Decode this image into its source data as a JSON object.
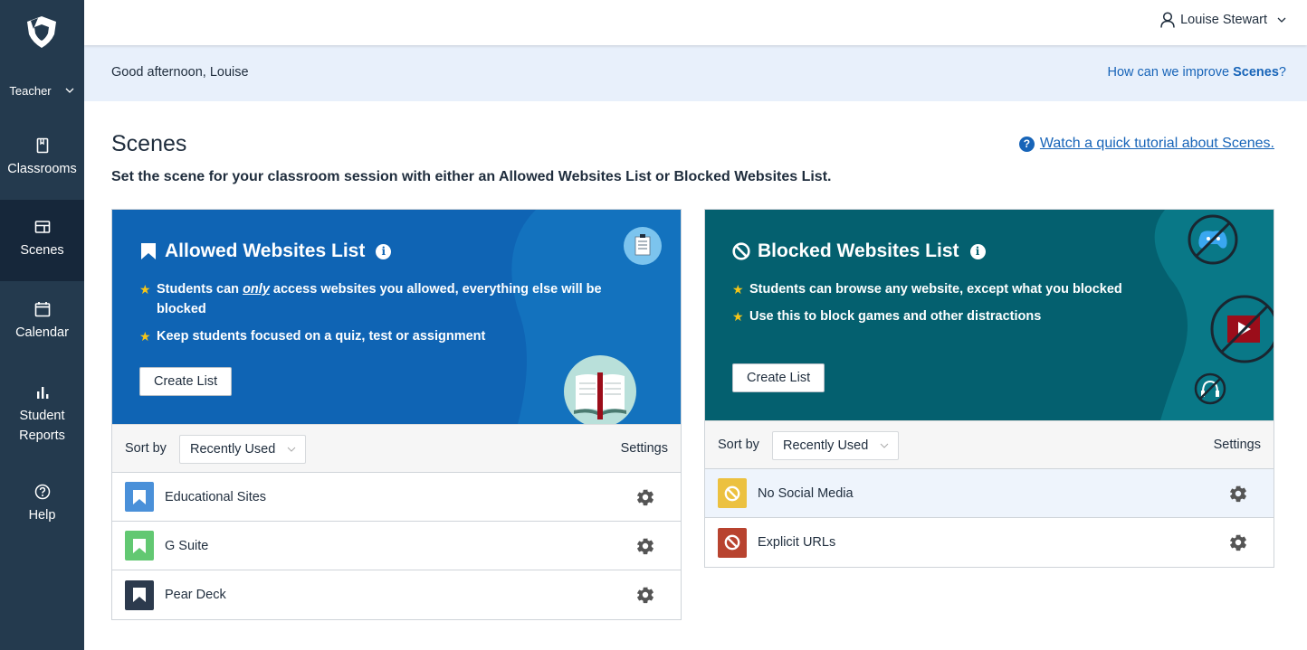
{
  "sidebar": {
    "role": "Teacher",
    "items": [
      {
        "label": "Classrooms",
        "icon": "book-icon"
      },
      {
        "label": "Scenes",
        "icon": "layout-icon",
        "active": true
      },
      {
        "label": "Calendar",
        "icon": "calendar-icon"
      },
      {
        "label": "Student Reports",
        "icon": "bar-chart-icon"
      },
      {
        "label": "Help",
        "icon": "help-circle-icon"
      }
    ]
  },
  "topbar": {
    "user_name": "Louise Stewart"
  },
  "greeting": {
    "text": "Good afternoon, Louise",
    "improve_prefix": "How can we improve ",
    "improve_bold": "Scenes",
    "improve_suffix": "?"
  },
  "page": {
    "title": "Scenes",
    "subtitle": "Set the scene for your classroom session with either an Allowed Websites List or Blocked Websites List.",
    "tutorial_link": "Watch a quick tutorial about Scenes."
  },
  "allowed": {
    "title": "Allowed Websites List",
    "bullet1_pre": "Students can ",
    "bullet1_em": "only",
    "bullet1_post": " access websites you allowed, everything else will be blocked",
    "bullet2": "Keep students focused on a quiz, test or assignment",
    "create_label": "Create List",
    "sort_label": "Sort by",
    "sort_value": "Recently Used",
    "settings_label": "Settings",
    "lists": [
      {
        "name": "Educational Sites",
        "color": "#4a90d9"
      },
      {
        "name": "G Suite",
        "color": "#62c872"
      },
      {
        "name": "Pear Deck",
        "color": "#2c3a4d"
      }
    ]
  },
  "blocked": {
    "title": "Blocked Websites List",
    "bullet1": "Students can browse any website, except what you blocked",
    "bullet2": "Use this to block games and other distractions",
    "create_label": "Create List",
    "sort_label": "Sort by",
    "sort_value": "Recently Used",
    "settings_label": "Settings",
    "lists": [
      {
        "name": "No Social Media",
        "color": "#ecc140",
        "highlighted": true
      },
      {
        "name": "Explicit URLs",
        "color": "#b8432f"
      }
    ]
  },
  "colors": {
    "sidebar": "#243a4e",
    "sidebar_active": "#16273a",
    "link": "#1764b8",
    "allowed_hero": "#0f64b4",
    "blocked_hero": "#04606f"
  }
}
